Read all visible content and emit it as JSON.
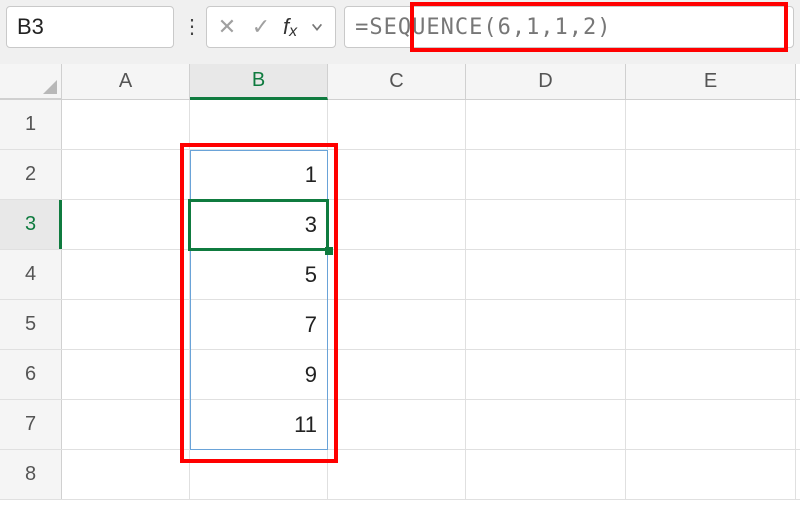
{
  "name_box": {
    "value": "B3"
  },
  "formula_bar": {
    "value": "=SEQUENCE(6,1,1,2)"
  },
  "columns": [
    "A",
    "B",
    "C",
    "D",
    "E"
  ],
  "active_col": "B",
  "row_headers": [
    1,
    2,
    3,
    4,
    5,
    6,
    7,
    8
  ],
  "active_row": 3,
  "cells": {
    "B2": "1",
    "B3": "3",
    "B4": "5",
    "B5": "7",
    "B6": "9",
    "B7": "11"
  },
  "icons": {
    "cancel": "✕",
    "confirm": "✓",
    "vdots": "⋮"
  }
}
